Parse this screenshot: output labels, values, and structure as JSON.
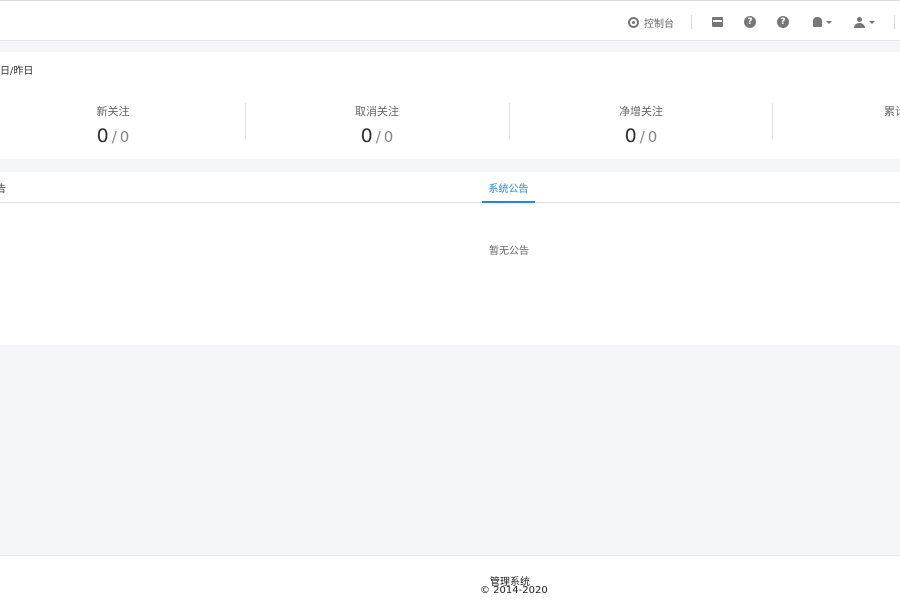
{
  "topbar": {
    "console_label": "控制台",
    "icons": [
      "dashboard-icon",
      "store-icon",
      "help-icon",
      "help-icon",
      "bell-icon",
      "user-icon"
    ]
  },
  "stats": {
    "title": "日/昨日",
    "items": [
      {
        "label": "新关注",
        "today": "0",
        "yesterday": "0"
      },
      {
        "label": "取消关注",
        "today": "0",
        "yesterday": "0"
      },
      {
        "label": "净增关注",
        "today": "0",
        "yesterday": "0"
      },
      {
        "label": "累计"
      }
    ],
    "slash": "/"
  },
  "announcements": {
    "left_tab": "告",
    "active_tab": "系统公告",
    "empty_text": "暂无公告"
  },
  "footer": {
    "name": "管理系统",
    "copyright": "© 2014-2020"
  },
  "colors": {
    "accent": "#1e88e5",
    "background": "#f5f6f8"
  }
}
